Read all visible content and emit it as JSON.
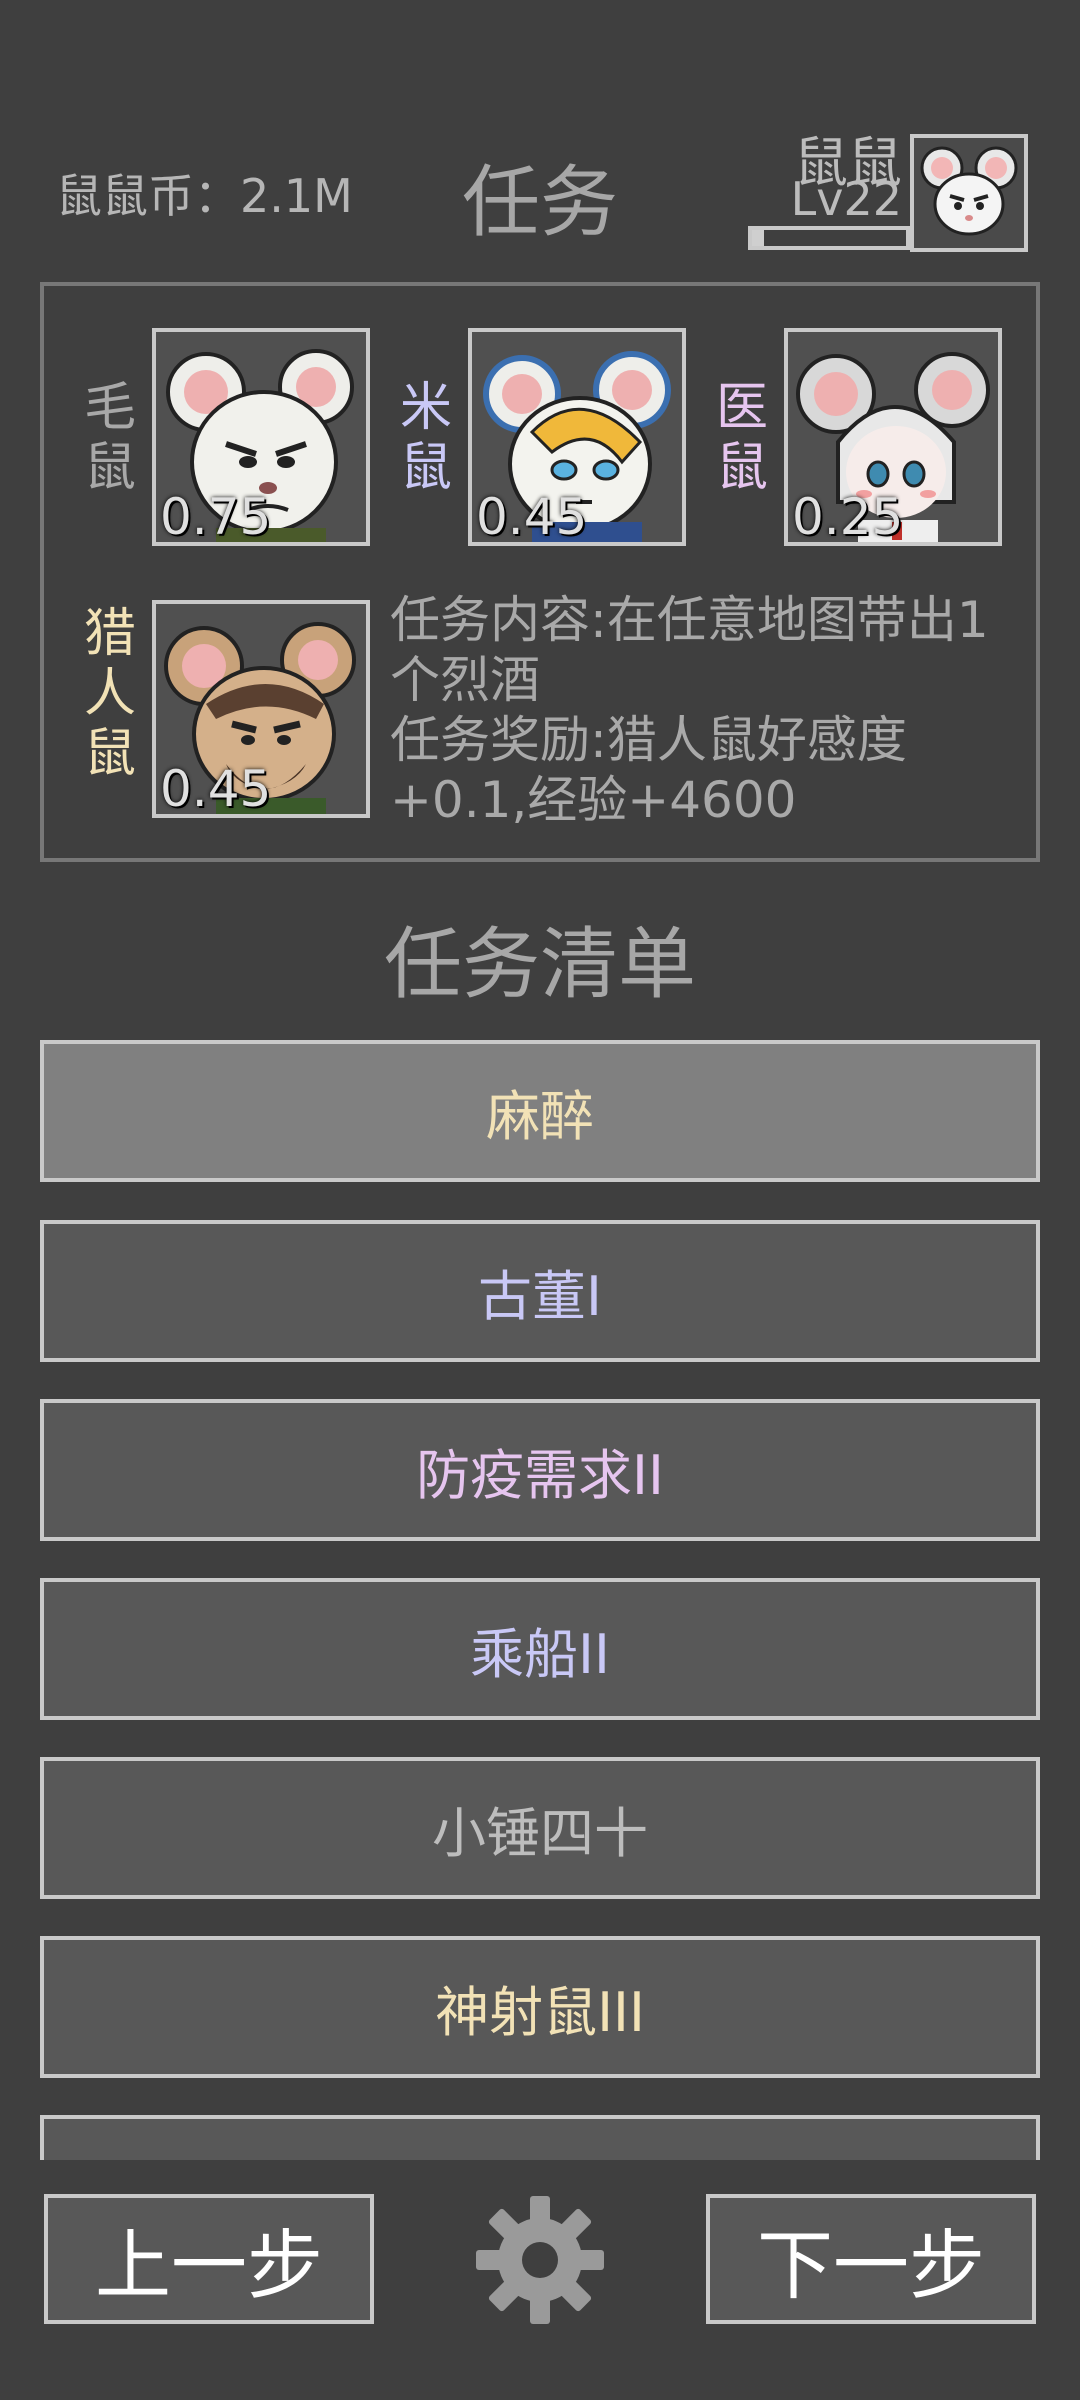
{
  "header": {
    "coins_label": "鼠鼠币：2.1M",
    "title": "任务",
    "player_name": "鼠鼠",
    "player_level": "Lv22",
    "xp_progress": 0.08
  },
  "npcs": [
    {
      "name": "毛鼠",
      "affinity": "0.75",
      "name_color": "#a8a8a8"
    },
    {
      "name": "米鼠",
      "affinity": "0.45",
      "name_color": "#c9c8f6"
    },
    {
      "name": "医鼠",
      "affinity": "0.25",
      "name_color": "#e6c5ef"
    },
    {
      "name": "猎人鼠",
      "affinity": "0.45",
      "name_color": "#f2e2b6"
    }
  ],
  "task": {
    "content": "任务内容:在任意地图带出1个烈酒",
    "reward": "任务奖励:猎人鼠好感度+0.1,经验+4600"
  },
  "task_list": {
    "title": "任务清单",
    "items": [
      {
        "label": "麻醉",
        "color": "#f2e2b6",
        "selected": true
      },
      {
        "label": "古董I",
        "color": "#c9c8f6",
        "selected": false
      },
      {
        "label": "防疫需求II",
        "color": "#e6c5ef",
        "selected": false
      },
      {
        "label": "乘船II",
        "color": "#c9c8f6",
        "selected": false
      },
      {
        "label": "小锤四十",
        "color": "#bdbdbd",
        "selected": false
      },
      {
        "label": "神射鼠III",
        "color": "#f2e2b6",
        "selected": false
      },
      {
        "label": "",
        "color": "#bdbdbd",
        "selected": false
      }
    ]
  },
  "footer": {
    "prev_label": "上一步",
    "next_label": "下一步",
    "settings_icon": "gear-icon"
  }
}
